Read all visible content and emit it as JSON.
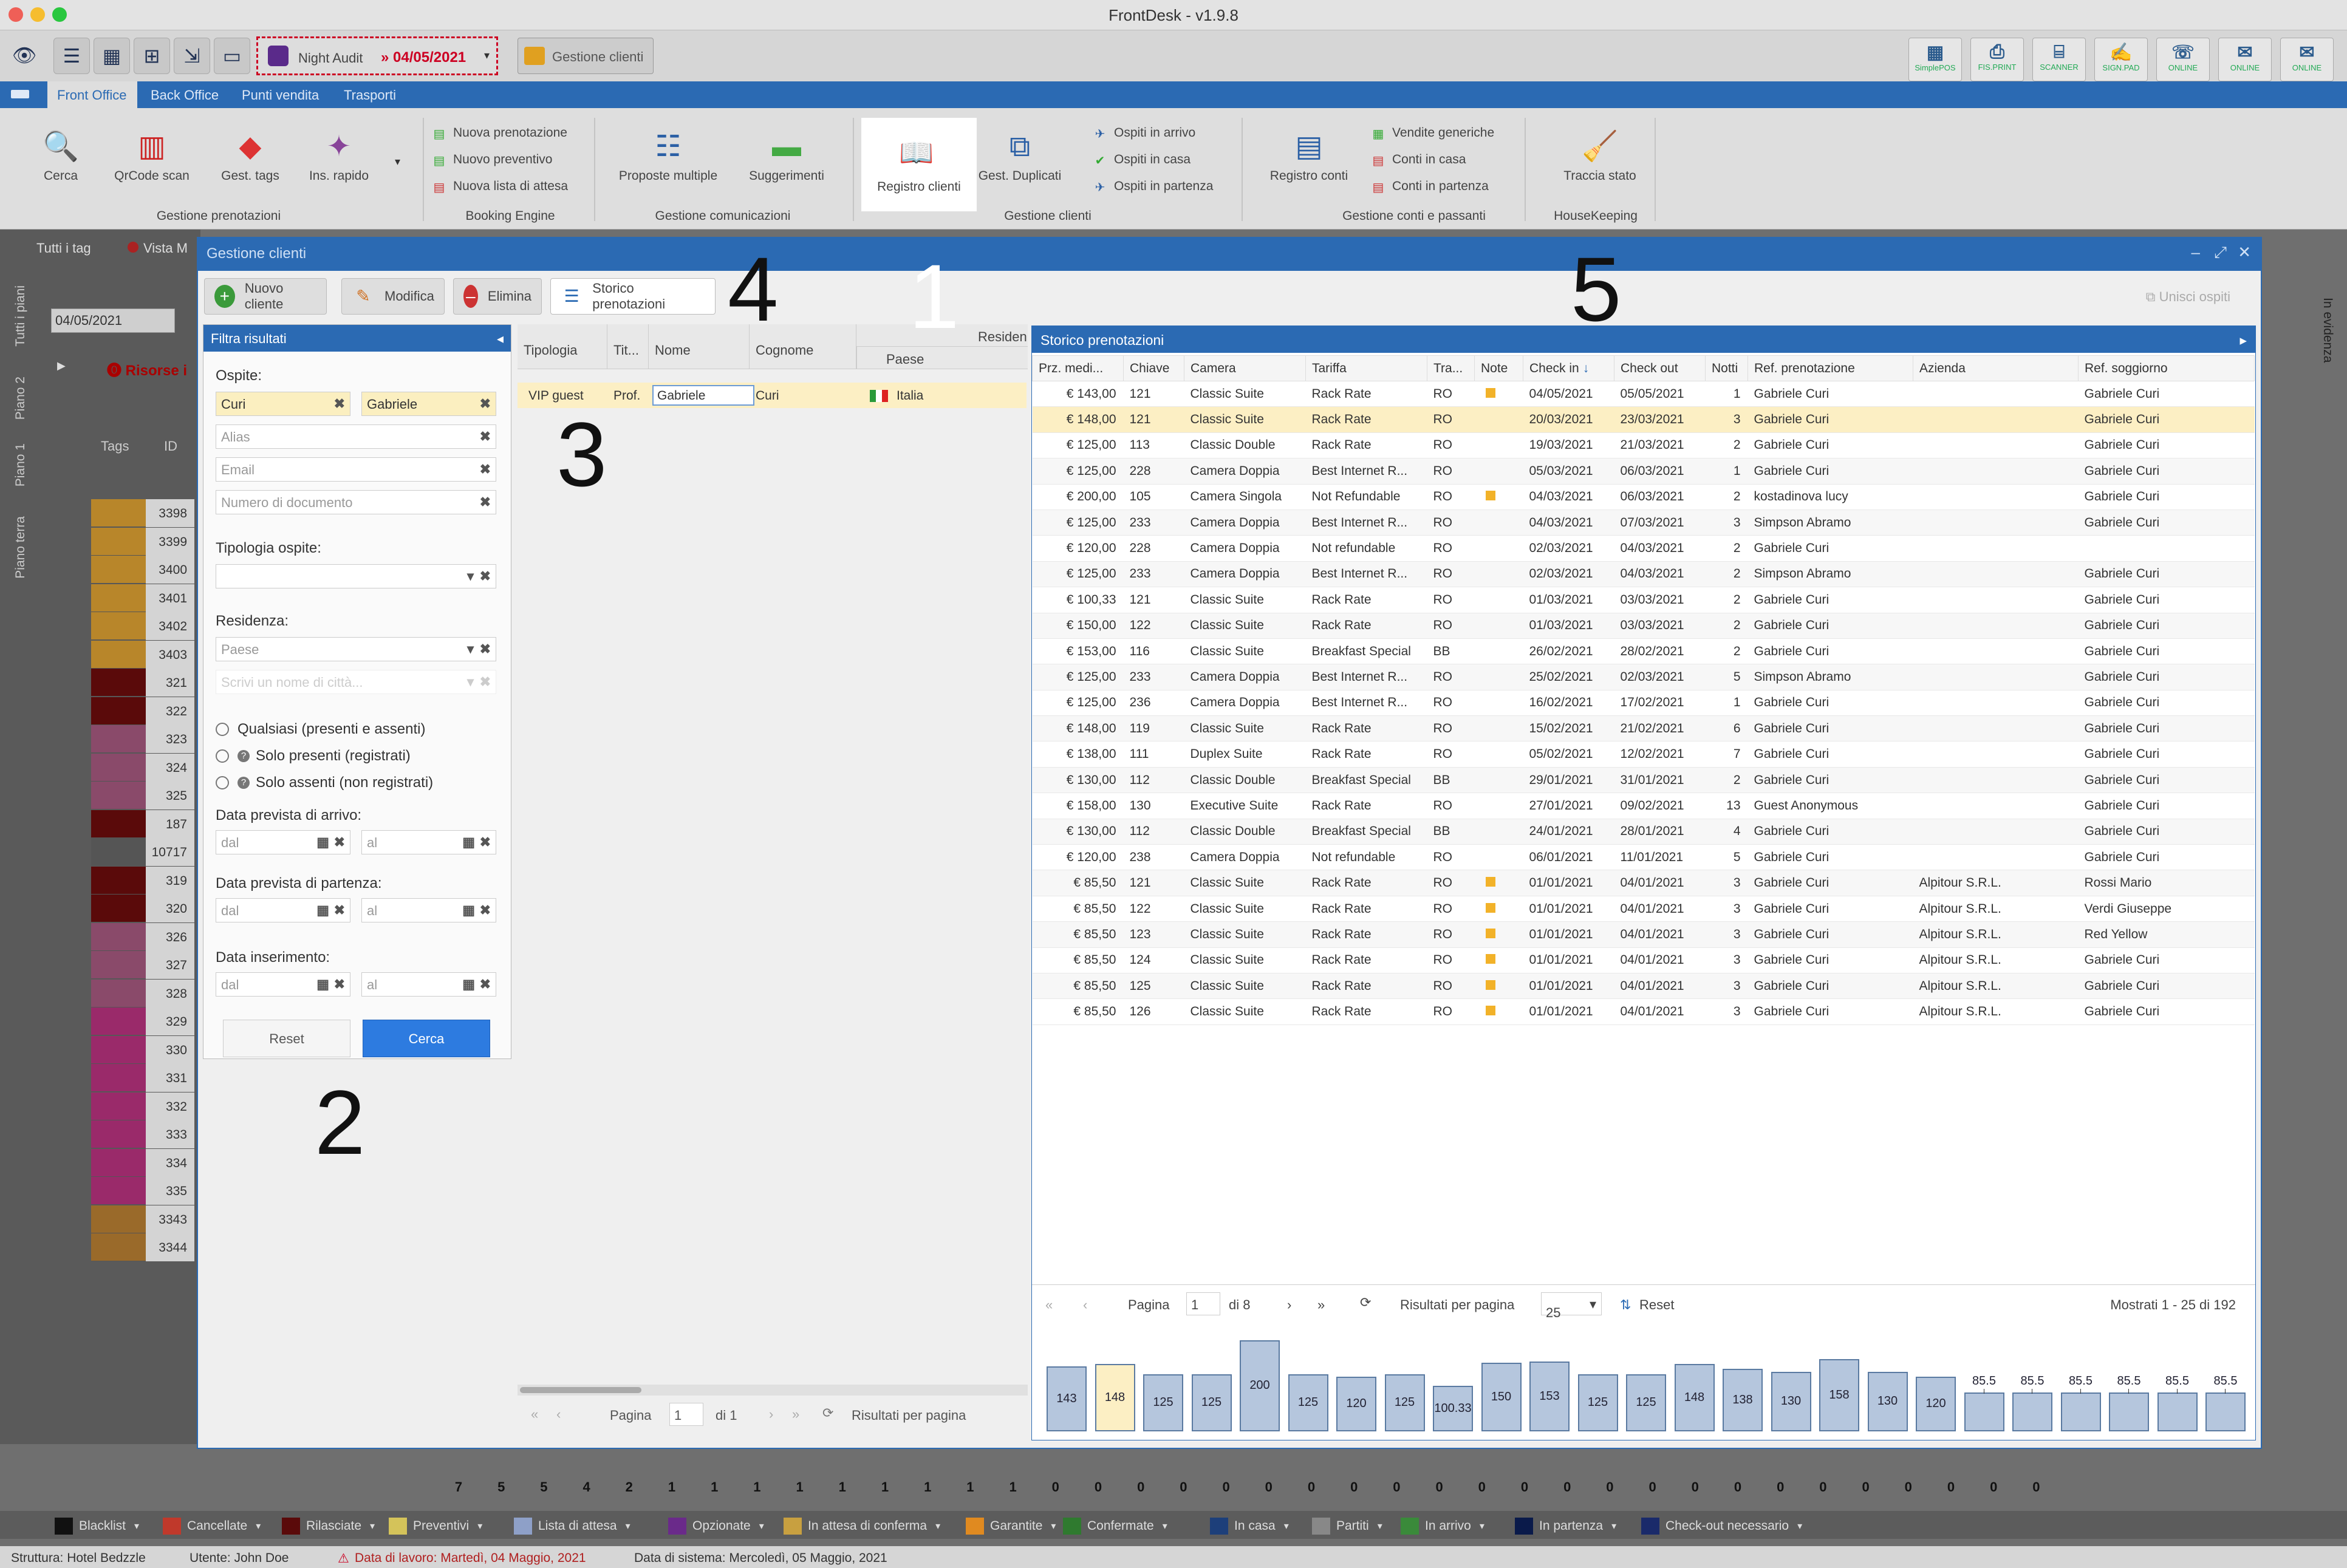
{
  "window": {
    "title": "FrontDesk - v1.9.8"
  },
  "toolbar": {
    "night_audit": "Night Audit",
    "date": "» 04/05/2021",
    "gestione_clienti": "Gestione clienti",
    "tools": [
      "SimplePOS",
      "FIS.PRINT",
      "SCANNER",
      "SIGN.PAD",
      "ONLINE",
      "ONLINE",
      "ONLINE"
    ]
  },
  "menu": [
    "Front Office",
    "Back Office",
    "Punti vendita",
    "Trasporti"
  ],
  "ribbon": {
    "cerca": "Cerca",
    "qrcode": "QrCode scan",
    "gest_tags": "Gest. tags",
    "ins_rapido": "Ins. rapido",
    "g1": "Gestione prenotazioni",
    "nuova_pren": "Nuova prenotazione",
    "nuovo_prev": "Nuovo preventivo",
    "nuova_lista": "Nuova lista di attesa",
    "g2": "Booking Engine",
    "proposte": "Proposte multiple",
    "suggerimenti": "Suggerimenti",
    "g3": "Gestione comunicazioni",
    "registro": "Registro clienti",
    "duplicati": "Gest. Duplicati",
    "arrivo": "Ospiti in arrivo",
    "casa": "Ospiti in casa",
    "partenza": "Ospiti in partenza",
    "g4": "Gestione clienti",
    "registro_conti": "Registro conti",
    "vendite": "Vendite generiche",
    "conti_casa": "Conti in casa",
    "conti_partenza": "Conti in partenza",
    "g5": "Gestione conti e passanti",
    "traccia": "Traccia stato",
    "g6": "HouseKeeping"
  },
  "background": {
    "tag_tab": "Tutti i tag",
    "vista": "Vista M",
    "date": "04/05/2021",
    "risorse": "Risorse i",
    "tags_col": "Tags",
    "id_col": "ID",
    "ids": [
      "3398",
      "3399",
      "3400",
      "3401",
      "3402",
      "3403",
      "321",
      "322",
      "323",
      "324",
      "325",
      "187",
      "10717",
      "319",
      "320",
      "326",
      "327",
      "328",
      "329",
      "330",
      "331",
      "332",
      "333",
      "334",
      "335",
      "3343",
      "3344"
    ],
    "side_tabs": [
      "Tutti i piani",
      "Piano 2",
      "Piano 1",
      "Piano terra"
    ],
    "right_tab": "In evidenza",
    "counts": [
      "7",
      "5",
      "5",
      "4",
      "2",
      "1",
      "1",
      "1",
      "1",
      "1",
      "1",
      "1",
      "1",
      "1",
      "0",
      "0",
      "0",
      "0",
      "0",
      "0",
      "0",
      "0",
      "0",
      "0",
      "0",
      "0",
      "0",
      "0",
      "0",
      "0",
      "0",
      "0",
      "0",
      "0",
      "0",
      "0",
      "0",
      "0"
    ]
  },
  "dialog": {
    "title": "Gestione clienti",
    "nuovo": "Nuovo cliente",
    "modifica": "Modifica",
    "elimina": "Elimina",
    "storico": "Storico prenotazioni",
    "unisci": "Unisci ospiti"
  },
  "filter": {
    "title": "Filtra risultati",
    "ospite": "Ospite:",
    "cognome": "Curi",
    "nome": "Gabriele",
    "alias": "Alias",
    "email": "Email",
    "doc": "Numero di documento",
    "tipologia": "Tipologia ospite:",
    "residenza": "Residenza:",
    "paese": "Paese",
    "citta": "Scrivi un nome di città...",
    "r1": "Qualsiasi (presenti e assenti)",
    "r2": "Solo presenti (registrati)",
    "r3": "Solo assenti (non registrati)",
    "arrivo": "Data prevista di arrivo:",
    "partenza": "Data prevista di partenza:",
    "inserimento": "Data inserimento:",
    "dal": "dal",
    "al": "al",
    "reset": "Reset",
    "cerca": "Cerca"
  },
  "list": {
    "headers": [
      "Tipologia",
      "Tit...",
      "Nome",
      "Cognome",
      "Residen",
      "Paese"
    ],
    "row": [
      "VIP guest",
      "Prof.",
      "Gabriele",
      "Curi",
      "Italia"
    ],
    "pagina": "Pagina",
    "page": "1",
    "di": "di 1",
    "risultati": "Risultati per pagina"
  },
  "storico": {
    "title": "Storico prenotazioni",
    "headers": [
      "Prz. medi...",
      "Chiave",
      "Camera",
      "Tariffa",
      "Tra...",
      "Note",
      "Check in",
      "Check out",
      "Notti",
      "Ref. prenotazione",
      "Azienda",
      "Ref. soggiorno"
    ],
    "rows": [
      [
        "€ 143,00",
        "121",
        "Classic Suite",
        "Rack Rate",
        "RO",
        "1",
        "04/05/2021",
        "05/05/2021",
        "1",
        "Gabriele Curi",
        "",
        "Gabriele Curi"
      ],
      [
        "€ 148,00",
        "121",
        "Classic Suite",
        "Rack Rate",
        "RO",
        "",
        "20/03/2021",
        "23/03/2021",
        "3",
        "Gabriele Curi",
        "",
        "Gabriele Curi"
      ],
      [
        "€ 125,00",
        "113",
        "Classic Double",
        "Rack Rate",
        "RO",
        "",
        "19/03/2021",
        "21/03/2021",
        "2",
        "Gabriele Curi",
        "",
        "Gabriele Curi"
      ],
      [
        "€ 125,00",
        "228",
        "Camera Doppia",
        "Best Internet R...",
        "RO",
        "",
        "05/03/2021",
        "06/03/2021",
        "1",
        "Gabriele Curi",
        "",
        "Gabriele Curi"
      ],
      [
        "€ 200,00",
        "105",
        "Camera Singola",
        "Not Refundable",
        "RO",
        "1",
        "04/03/2021",
        "06/03/2021",
        "2",
        "kostadinova lucy",
        "",
        "Gabriele Curi"
      ],
      [
        "€ 125,00",
        "233",
        "Camera Doppia",
        "Best Internet R...",
        "RO",
        "",
        "04/03/2021",
        "07/03/2021",
        "3",
        "Simpson Abramo",
        "",
        "Gabriele Curi"
      ],
      [
        "€ 120,00",
        "228",
        "Camera Doppia",
        "Not refundable",
        "RO",
        "",
        "02/03/2021",
        "04/03/2021",
        "2",
        "Gabriele Curi",
        "",
        ""
      ],
      [
        "€ 125,00",
        "233",
        "Camera Doppia",
        "Best Internet R...",
        "RO",
        "",
        "02/03/2021",
        "04/03/2021",
        "2",
        "Simpson Abramo",
        "",
        "Gabriele Curi"
      ],
      [
        "€ 100,33",
        "121",
        "Classic Suite",
        "Rack Rate",
        "RO",
        "",
        "01/03/2021",
        "03/03/2021",
        "2",
        "Gabriele Curi",
        "",
        "Gabriele Curi"
      ],
      [
        "€ 150,00",
        "122",
        "Classic Suite",
        "Rack Rate",
        "RO",
        "",
        "01/03/2021",
        "03/03/2021",
        "2",
        "Gabriele Curi",
        "",
        "Gabriele Curi"
      ],
      [
        "€ 153,00",
        "116",
        "Classic Suite",
        "Breakfast Special",
        "BB",
        "",
        "26/02/2021",
        "28/02/2021",
        "2",
        "Gabriele Curi",
        "",
        "Gabriele Curi"
      ],
      [
        "€ 125,00",
        "233",
        "Camera Doppia",
        "Best Internet R...",
        "RO",
        "",
        "25/02/2021",
        "02/03/2021",
        "5",
        "Simpson Abramo",
        "",
        "Gabriele Curi"
      ],
      [
        "€ 125,00",
        "236",
        "Camera Doppia",
        "Best Internet R...",
        "RO",
        "",
        "16/02/2021",
        "17/02/2021",
        "1",
        "Gabriele Curi",
        "",
        "Gabriele Curi"
      ],
      [
        "€ 148,00",
        "119",
        "Classic Suite",
        "Rack Rate",
        "RO",
        "",
        "15/02/2021",
        "21/02/2021",
        "6",
        "Gabriele Curi",
        "",
        "Gabriele Curi"
      ],
      [
        "€ 138,00",
        "111",
        "Duplex Suite",
        "Rack Rate",
        "RO",
        "",
        "05/02/2021",
        "12/02/2021",
        "7",
        "Gabriele Curi",
        "",
        "Gabriele Curi"
      ],
      [
        "€ 130,00",
        "112",
        "Classic Double",
        "Breakfast Special",
        "BB",
        "",
        "29/01/2021",
        "31/01/2021",
        "2",
        "Gabriele Curi",
        "",
        "Gabriele Curi"
      ],
      [
        "€ 158,00",
        "130",
        "Executive Suite",
        "Rack Rate",
        "RO",
        "",
        "27/01/2021",
        "09/02/2021",
        "13",
        "Guest Anonymous",
        "",
        "Gabriele Curi"
      ],
      [
        "€ 130,00",
        "112",
        "Classic Double",
        "Breakfast Special",
        "BB",
        "",
        "24/01/2021",
        "28/01/2021",
        "4",
        "Gabriele Curi",
        "",
        "Gabriele Curi"
      ],
      [
        "€ 120,00",
        "238",
        "Camera Doppia",
        "Not refundable",
        "RO",
        "",
        "06/01/2021",
        "11/01/2021",
        "5",
        "Gabriele Curi",
        "",
        "Gabriele Curi"
      ],
      [
        "€ 85,50",
        "121",
        "Classic Suite",
        "Rack Rate",
        "RO",
        "1",
        "01/01/2021",
        "04/01/2021",
        "3",
        "Gabriele Curi",
        "Alpitour S.R.L.",
        "Rossi Mario"
      ],
      [
        "€ 85,50",
        "122",
        "Classic Suite",
        "Rack Rate",
        "RO",
        "1",
        "01/01/2021",
        "04/01/2021",
        "3",
        "Gabriele Curi",
        "Alpitour S.R.L.",
        "Verdi Giuseppe"
      ],
      [
        "€ 85,50",
        "123",
        "Classic Suite",
        "Rack Rate",
        "RO",
        "1",
        "01/01/2021",
        "04/01/2021",
        "3",
        "Gabriele Curi",
        "Alpitour S.R.L.",
        "Red Yellow"
      ],
      [
        "€ 85,50",
        "124",
        "Classic Suite",
        "Rack Rate",
        "RO",
        "1",
        "01/01/2021",
        "04/01/2021",
        "3",
        "Gabriele Curi",
        "Alpitour S.R.L.",
        "Gabriele Curi"
      ],
      [
        "€ 85,50",
        "125",
        "Classic Suite",
        "Rack Rate",
        "RO",
        "1",
        "01/01/2021",
        "04/01/2021",
        "3",
        "Gabriele Curi",
        "Alpitour S.R.L.",
        "Gabriele Curi"
      ],
      [
        "€ 85,50",
        "126",
        "Classic Suite",
        "Rack Rate",
        "RO",
        "1",
        "01/01/2021",
        "04/01/2021",
        "3",
        "Gabriele Curi",
        "Alpitour S.R.L.",
        "Gabriele Curi"
      ]
    ],
    "pager": {
      "pagina": "Pagina",
      "page": "1",
      "di": "di 8",
      "risultati": "Risultati per pagina",
      "per_page": "25",
      "reset": "Reset",
      "mostrati": "Mostrati 1 - 25 di 192"
    },
    "bars": [
      "143",
      "148",
      "125",
      "125",
      "200",
      "125",
      "120",
      "125",
      "100.33",
      "150",
      "153",
      "125",
      "125",
      "148",
      "138",
      "130",
      "158",
      "130",
      "120",
      "85.5",
      "85.5",
      "85.5",
      "85.5",
      "85.5",
      "85.5"
    ]
  },
  "chart_data": {
    "type": "bar",
    "values": [
      143,
      148,
      125,
      125,
      200,
      125,
      120,
      125,
      100.33,
      150,
      153,
      125,
      125,
      148,
      138,
      130,
      158,
      130,
      120,
      85.5,
      85.5,
      85.5,
      85.5,
      85.5,
      85.5
    ],
    "selected_index": 1
  },
  "annotations": [
    "1",
    "2",
    "3",
    "4",
    "5"
  ],
  "legend": [
    {
      "label": "Blacklist",
      "color": "#111111"
    },
    {
      "label": "Cancellate",
      "color": "#c0392b"
    },
    {
      "label": "Rilasciate",
      "color": "#5a0a0a"
    },
    {
      "label": "Preventivi",
      "color": "#d4c35a"
    },
    {
      "label": "Lista di attesa",
      "color": "#8ea0c8"
    },
    {
      "label": "Opzionate",
      "color": "#6a2a8a"
    },
    {
      "label": "In attesa di conferma",
      "color": "#c8a040"
    },
    {
      "label": "Garantite",
      "color": "#e08a20"
    },
    {
      "label": "Confermate",
      "color": "#2f7a2f"
    },
    {
      "label": "In casa",
      "color": "#1d3f7a"
    },
    {
      "label": "Partiti",
      "color": "#888888"
    },
    {
      "label": "In arrivo",
      "color": "#3a8a3a"
    },
    {
      "label": "In partenza",
      "color": "#0a1a4a"
    },
    {
      "label": "Check-out necessario",
      "color": "#1a2a6a"
    }
  ],
  "status": {
    "struttura": "Struttura: Hotel Bedzzle",
    "utente": "Utente: John Doe",
    "lavoro": "Data di lavoro: Martedì, 04 Maggio, 2021",
    "sistema": "Data di sistema: Mercoledì, 05 Maggio, 2021"
  }
}
